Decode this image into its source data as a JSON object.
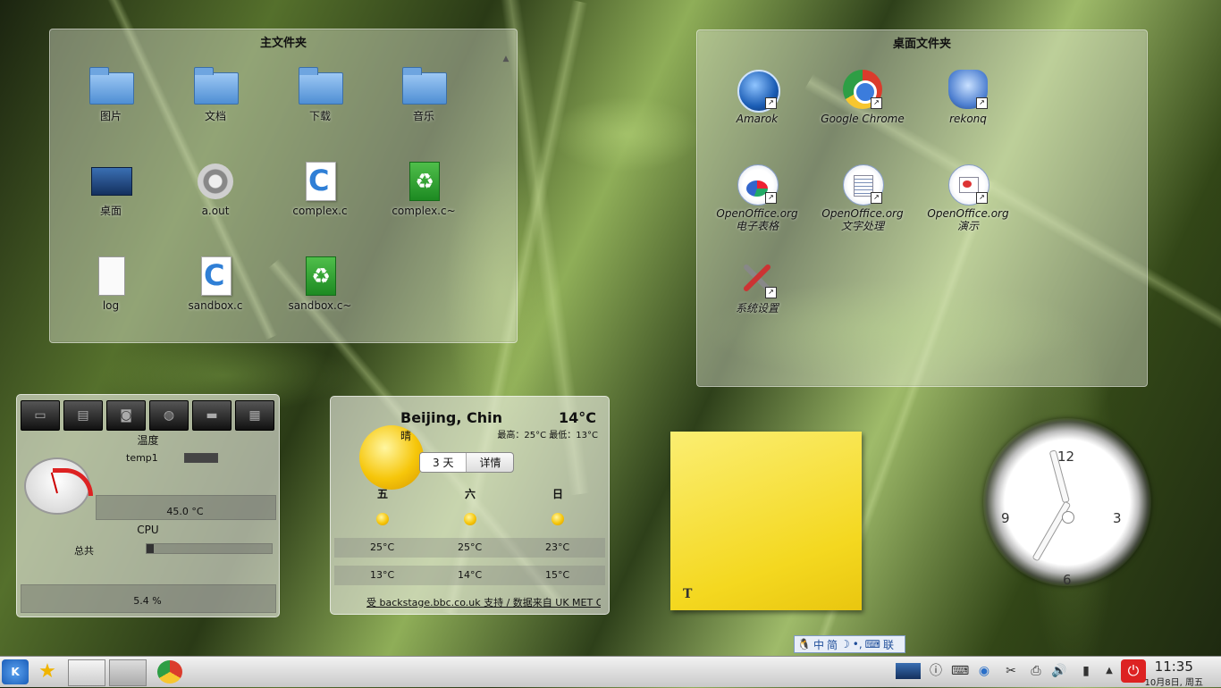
{
  "home_folder": {
    "title": "主文件夹",
    "items": [
      {
        "label": "图片",
        "icon": "folder-icon"
      },
      {
        "label": "文档",
        "icon": "folder-icon"
      },
      {
        "label": "下载",
        "icon": "folder-icon"
      },
      {
        "label": "音乐",
        "icon": "folder-icon"
      },
      {
        "label": "桌面",
        "icon": "desktop-folder-icon"
      },
      {
        "label": "a.out",
        "icon": "executable-gear-icon"
      },
      {
        "label": "complex.c",
        "icon": "c-source-icon"
      },
      {
        "label": "complex.c~",
        "icon": "backup-file-icon"
      },
      {
        "label": "log",
        "icon": "text-file-icon"
      },
      {
        "label": "sandbox.c",
        "icon": "c-source-icon"
      },
      {
        "label": "sandbox.c~",
        "icon": "backup-file-icon"
      }
    ]
  },
  "desktop_folder": {
    "title": "桌面文件夹",
    "items": [
      {
        "label": "Amarok",
        "icon": "amarok-icon"
      },
      {
        "label": "Google Chrome",
        "icon": "chrome-icon"
      },
      {
        "label": "rekonq",
        "icon": "rekonq-icon"
      },
      {
        "label": "OpenOffice.org",
        "label2": "电子表格",
        "icon": "calc-icon"
      },
      {
        "label": "OpenOffice.org",
        "label2": "文字处理",
        "icon": "writer-icon"
      },
      {
        "label": "OpenOffice.org",
        "label2": "演示",
        "icon": "impress-icon"
      },
      {
        "label": "系统设置",
        "icon": "system-settings-icon"
      }
    ]
  },
  "system_monitor": {
    "temperature_title": "温度",
    "sensor_label": "temp1",
    "temperature_value": "45.0 °C",
    "cpu_title": "CPU",
    "cpu_total_label": "总共",
    "cpu_value": "5.4 %",
    "cpu_fraction": 0.054
  },
  "weather": {
    "location": "Beijing, Chin",
    "current_temp": "14°C",
    "condition": "晴",
    "high_low": "最高：25°C 最低：13°C",
    "tab_days": "3 天",
    "tab_details": "详情",
    "days": [
      {
        "day": "五",
        "high": "25°C",
        "low": "13°C"
      },
      {
        "day": "六",
        "high": "25°C",
        "low": "14°C"
      },
      {
        "day": "日",
        "high": "23°C",
        "low": "15°C"
      }
    ],
    "credit": "受 backstage.bbc.co.uk 支持 / 数据来自 UK MET Offic"
  },
  "sticky_note": {
    "text": ""
  },
  "analog_clock": {
    "n12": "12",
    "n3": "3",
    "n6": "6",
    "n9": "9"
  },
  "ime_bar": {
    "lang": "中",
    "mode": "简",
    "end": "联"
  },
  "taskbar": {
    "time": "11:35",
    "date": "10月8日, 周五"
  }
}
